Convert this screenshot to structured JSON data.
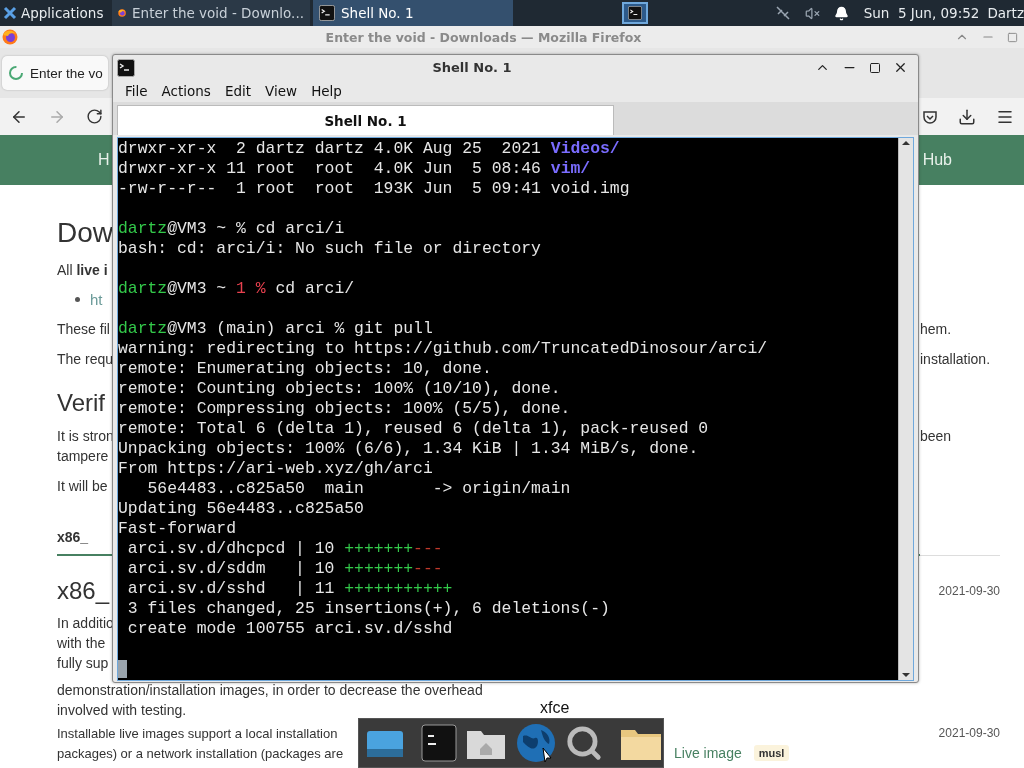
{
  "panel": {
    "apps_label": "Applications",
    "tasks": [
      {
        "label": "Enter the void - Downlo...",
        "kind": "browser",
        "selected": false
      },
      {
        "label": "Shell No. 1",
        "kind": "terminal",
        "selected": true
      }
    ],
    "clock": "Sun  5 Jun, 09:52",
    "user": "Dartz"
  },
  "browser": {
    "title": "Enter the void - Downloads — Mozilla Firefox",
    "tab": "Enter the vo",
    "header_links": [
      "H",
      "Hub"
    ],
    "rows": [
      {
        "kind": "heading",
        "left": "Dow"
      },
      {
        "kind": "para",
        "left": "All **live i**"
      },
      {
        "kind": "bullet",
        "left": "ht"
      },
      {
        "kind": "para",
        "left": "These fil",
        "right": {
          "text": "hem.",
          "kind": "text"
        }
      },
      {
        "kind": "para",
        "left": "The requ",
        "right": {
          "text": "installation.",
          "kind": "text"
        }
      },
      {
        "kind": "subheading",
        "left": "Verif"
      },
      {
        "kind": "para",
        "left": "It is stron",
        "right": {
          "text": "been",
          "kind": "text"
        }
      },
      {
        "kind": "para",
        "left": "tampere"
      },
      {
        "kind": "para",
        "left": "It will be"
      },
      {
        "kind": "tab",
        "left": "x86_"
      },
      {
        "kind": "subheading",
        "left": "x86_",
        "right": {
          "text": "2021-09-30",
          "kind": "date"
        }
      },
      {
        "kind": "para",
        "left": "In additio"
      },
      {
        "kind": "para",
        "left": "with the"
      },
      {
        "kind": "para",
        "left": "fully sup"
      },
      {
        "kind": "para",
        "left": "demonstration/installation images, in order to decrease the overhead"
      },
      {
        "kind": "para",
        "left": "involved with testing."
      },
      {
        "kind": "para",
        "left": "Installable live images support a local installation",
        "right": {
          "text": "2021-09-30",
          "kind": "date"
        }
      },
      {
        "kind": "para",
        "left": "packages) or a network installation (packages are",
        "middle": "Live image",
        "tag": "musl"
      }
    ]
  },
  "terminal": {
    "title": "Shell No. 1",
    "menu": [
      "File",
      "Actions",
      "Edit",
      "View",
      "Help"
    ],
    "tabs": [
      {
        "label": "Shell No. 1",
        "selected": true
      }
    ],
    "lines": [
      {
        "kind": "text",
        "segments": [
          {
            "text": "drwxr-xr-x  2 dartz dartz 4.0K Aug 25  2021 ",
            "kind": "plain"
          },
          {
            "text": "Videos/",
            "kind": "dir"
          }
        ]
      },
      {
        "kind": "text",
        "segments": [
          {
            "text": "drwxr-xr-x 11 root  root  4.0K Jun  5 08:46 ",
            "kind": "plain"
          },
          {
            "text": "vim/",
            "kind": "dir"
          }
        ]
      },
      {
        "kind": "text",
        "segments": [
          {
            "text": "-rw-r--r--  1 root  root  193K Jun  5 09:41 void.img",
            "kind": "plain"
          }
        ]
      },
      {
        "kind": "blank"
      },
      {
        "kind": "text",
        "segments": [
          {
            "text": "dartz",
            "kind": "user"
          },
          {
            "text": "@VM3 ~ % cd arci/i",
            "kind": "plain"
          }
        ]
      },
      {
        "kind": "text",
        "segments": [
          {
            "text": "bash: cd: arci/i: No such file or directory",
            "kind": "plain"
          }
        ]
      },
      {
        "kind": "blank"
      },
      {
        "kind": "text",
        "segments": [
          {
            "text": "dartz",
            "kind": "user"
          },
          {
            "text": "@VM3 ~ ",
            "kind": "plain"
          },
          {
            "text": "1 %",
            "kind": "error"
          },
          {
            "text": " cd arci/",
            "kind": "plain"
          }
        ]
      },
      {
        "kind": "blank"
      },
      {
        "kind": "text",
        "segments": [
          {
            "text": "dartz",
            "kind": "user"
          },
          {
            "text": "@VM3 (main) arci % git pull",
            "kind": "plain"
          }
        ]
      },
      {
        "kind": "text",
        "segments": [
          {
            "text": "warning: redirecting to https://github.com/TruncatedDinosour/arci/",
            "kind": "plain"
          }
        ]
      },
      {
        "kind": "text",
        "segments": [
          {
            "text": "remote: Enumerating objects: 10, done.",
            "kind": "plain"
          }
        ]
      },
      {
        "kind": "text",
        "segments": [
          {
            "text": "remote: Counting objects: 100% (10/10), done.",
            "kind": "plain"
          }
        ]
      },
      {
        "kind": "text",
        "segments": [
          {
            "text": "remote: Compressing objects: 100% (5/5), done.",
            "kind": "plain"
          }
        ]
      },
      {
        "kind": "text",
        "segments": [
          {
            "text": "remote: Total 6 (delta 1), reused 6 (delta 1), pack-reused 0",
            "kind": "plain"
          }
        ]
      },
      {
        "kind": "text",
        "segments": [
          {
            "text": "Unpacking objects: 100% (6/6), 1.34 KiB | 1.34 MiB/s, done.",
            "kind": "plain"
          }
        ]
      },
      {
        "kind": "text",
        "segments": [
          {
            "text": "From https://ari-web.xyz/gh/arci",
            "kind": "plain"
          }
        ]
      },
      {
        "kind": "text",
        "segments": [
          {
            "text": "   56e4483..c825a50  main       -> origin/main",
            "kind": "plain"
          }
        ]
      },
      {
        "kind": "text",
        "segments": [
          {
            "text": "Updating 56e4483..c825a50",
            "kind": "plain"
          }
        ]
      },
      {
        "kind": "text",
        "segments": [
          {
            "text": "Fast-forward",
            "kind": "plain"
          }
        ]
      },
      {
        "kind": "text",
        "segments": [
          {
            "text": " arci.sv.d/dhcpcd | 10 ",
            "kind": "plain"
          },
          {
            "text": "+++++++",
            "kind": "plus"
          },
          {
            "text": "---",
            "kind": "minus"
          }
        ]
      },
      {
        "kind": "text",
        "segments": [
          {
            "text": " arci.sv.d/sddm   | 10 ",
            "kind": "plain"
          },
          {
            "text": "+++++++",
            "kind": "plus"
          },
          {
            "text": "---",
            "kind": "minus"
          }
        ]
      },
      {
        "kind": "text",
        "segments": [
          {
            "text": " arci.sv.d/sshd   | 11 ",
            "kind": "plain"
          },
          {
            "text": "+++++++++++",
            "kind": "plus"
          }
        ]
      },
      {
        "kind": "text",
        "segments": [
          {
            "text": " 3 files changed, 25 insertions(+), 6 deletions(-)",
            "kind": "plain"
          }
        ]
      },
      {
        "kind": "text",
        "segments": [
          {
            "text": " create mode 100755 arci.sv.d/sshd",
            "kind": "plain"
          }
        ]
      },
      {
        "kind": "blank"
      },
      {
        "kind": "cursor"
      }
    ]
  },
  "dock": {
    "label": "xfce"
  }
}
